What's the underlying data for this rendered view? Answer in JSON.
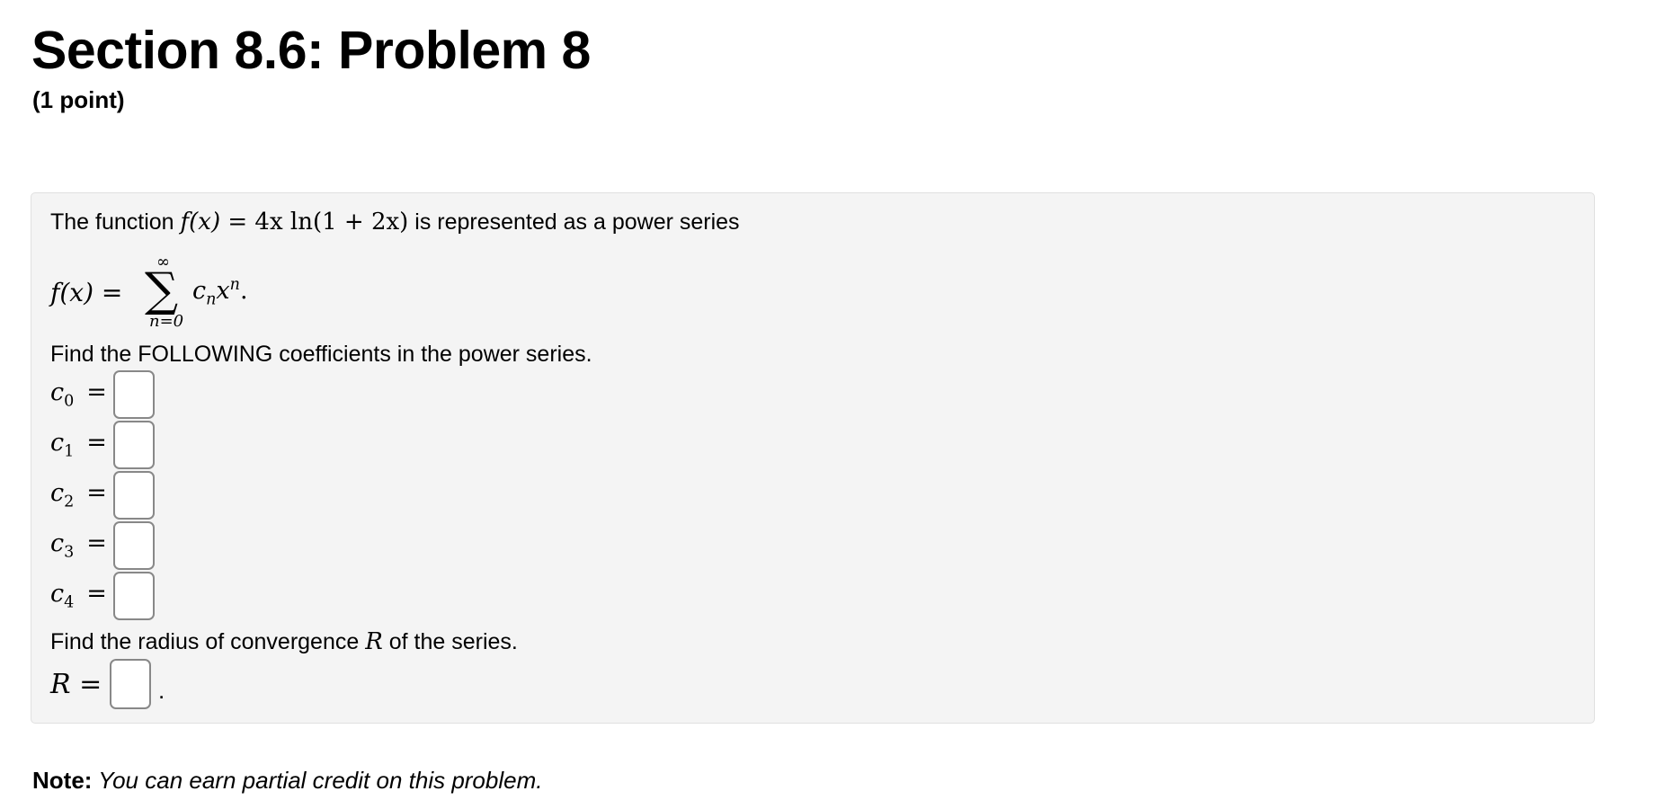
{
  "header": {
    "title": "Section 8.6: Problem 8",
    "points": "(1 point)"
  },
  "problem": {
    "intro_prefix": "The function ",
    "function_lhs": "f(x) = ",
    "function_rhs": "4x ln(1 + 2x)",
    "intro_suffix": " is represented as a power series",
    "series": {
      "lhs": "f(x) =",
      "sum_symbol": "∑",
      "upper_limit": "∞",
      "lower_limit": "n=0",
      "term_base": "c",
      "term_sub": "n",
      "term_var": "x",
      "term_sup": "n",
      "term_end": "."
    },
    "coef_prompt": "Find the FOLLOWING coefficients in the power series.",
    "coefficients": [
      {
        "symbol": "c",
        "sub": "0",
        "eq": "=",
        "value": ""
      },
      {
        "symbol": "c",
        "sub": "1",
        "eq": "=",
        "value": ""
      },
      {
        "symbol": "c",
        "sub": "2",
        "eq": "=",
        "value": ""
      },
      {
        "symbol": "c",
        "sub": "3",
        "eq": "=",
        "value": ""
      },
      {
        "symbol": "c",
        "sub": "4",
        "eq": "=",
        "value": ""
      }
    ],
    "radius_prompt_prefix": "Find the radius of convergence ",
    "radius_symbol": "R",
    "radius_prompt_suffix": " of the series.",
    "radius_label": "R =",
    "radius_value": "",
    "radius_end": "."
  },
  "note": {
    "label": "Note:",
    "text": " You can earn partial credit on this problem."
  },
  "colors": {
    "box_background": "#f4f4f4",
    "box_border": "#e0e0e0",
    "input_border": "#888888"
  }
}
